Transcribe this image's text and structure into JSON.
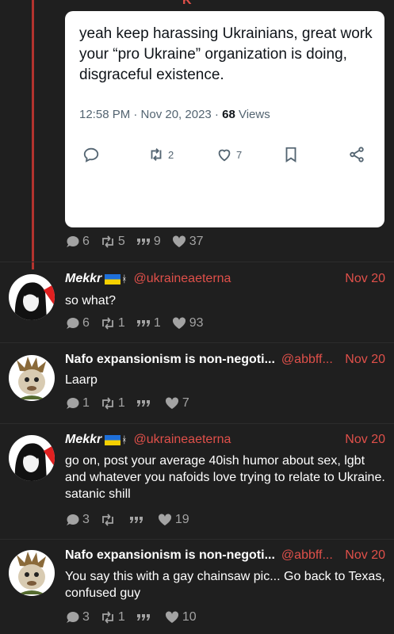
{
  "top_glyph": "K",
  "embed": {
    "text": "yeah keep harassing Ukrainians, great work your “pro Ukraine” organization is doing, disgraceful existence.",
    "time": "12:58 PM · Nov 20, 2023 · ",
    "views_count": "68",
    "views_label": " Views",
    "retweets": "2",
    "likes": "7"
  },
  "main_stats": {
    "replies": "6",
    "retweets": "5",
    "quotes": "9",
    "likes": "37"
  },
  "posts": [
    {
      "author": "Mekkr",
      "handle": "@ukraineaeterna",
      "date": "Nov 20",
      "text": "so what?",
      "replies": "6",
      "retweets": "1",
      "quotes": "1",
      "likes": "93"
    },
    {
      "author": "Nafo expansionism is non-negoti...",
      "handle": "@abbff...",
      "date": "Nov 20",
      "text": "Laarp",
      "replies": "1",
      "retweets": "1",
      "quotes": "",
      "likes": "7"
    },
    {
      "author": "Mekkr",
      "handle": "@ukraineaeterna",
      "date": "Nov 20",
      "text": "go on, post your average 40ish humor about sex, lgbt and whatever you nafoids love trying to relate to Ukraine. satanic shill",
      "replies": "3",
      "retweets": "",
      "quotes": "",
      "likes": "19"
    },
    {
      "author": "Nafo expansionism is non-negoti...",
      "handle": "@abbff...",
      "date": "Nov 20",
      "text": "You say this with a gay chainsaw pic... Go back to Texas, confused guy",
      "replies": "3",
      "retweets": "1",
      "quotes": "",
      "likes": "10"
    }
  ],
  "colors": {
    "accent": "#e0504a",
    "thread_line": "#b3332e",
    "background": "#1f1f1f",
    "muted": "#a3a3a3"
  }
}
